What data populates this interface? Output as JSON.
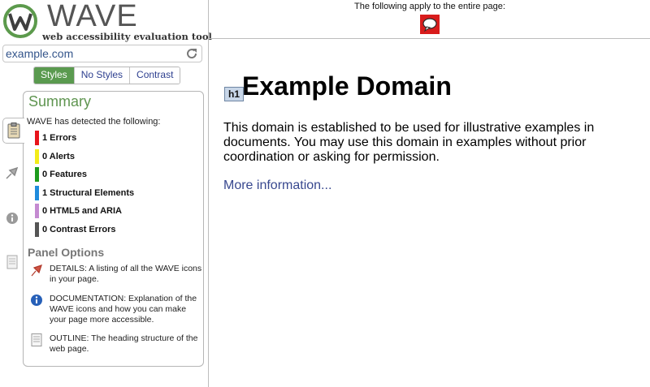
{
  "logo": {
    "brand": "WAVE",
    "tagline": "web accessibility evaluation tool"
  },
  "url_input": {
    "value": "example.com"
  },
  "view_tabs": [
    "Styles",
    "No Styles",
    "Contrast"
  ],
  "summary": {
    "title": "Summary",
    "detected_text": "WAVE has detected the following:",
    "items": [
      {
        "label": "1 Errors",
        "color": "#e8141b"
      },
      {
        "label": "0 Alerts",
        "color": "#f3ec19"
      },
      {
        "label": "0 Features",
        "color": "#1d9b1d"
      },
      {
        "label": "1 Structural Elements",
        "color": "#1f8bdc"
      },
      {
        "label": "0 HTML5 and ARIA",
        "color": "#c48ad1"
      },
      {
        "label": "0 Contrast Errors",
        "color": "#555555"
      }
    ]
  },
  "panel_options": {
    "title": "Panel Options",
    "details": "DETAILS: A listing of all the WAVE icons in your page.",
    "documentation": "DOCUMENTATION: Explanation of the WAVE icons and how you can make your page more accessible.",
    "outline": "OUTLINE: The heading structure of the web page."
  },
  "sidebar_tabs": [
    "clipboard-icon",
    "flag-icon",
    "info-icon",
    "document-icon"
  ],
  "page_bar": {
    "text": "The following apply to the entire page:"
  },
  "content": {
    "h1_tag": "h1",
    "heading": "Example Domain",
    "paragraph": "This domain is established to be used for illustrative examples in documents. You may use this domain in examples without prior coordination or asking for permission.",
    "link": "More information..."
  },
  "colors": {
    "accent_green": "#5a9a4f",
    "link_blue": "#38488f"
  }
}
